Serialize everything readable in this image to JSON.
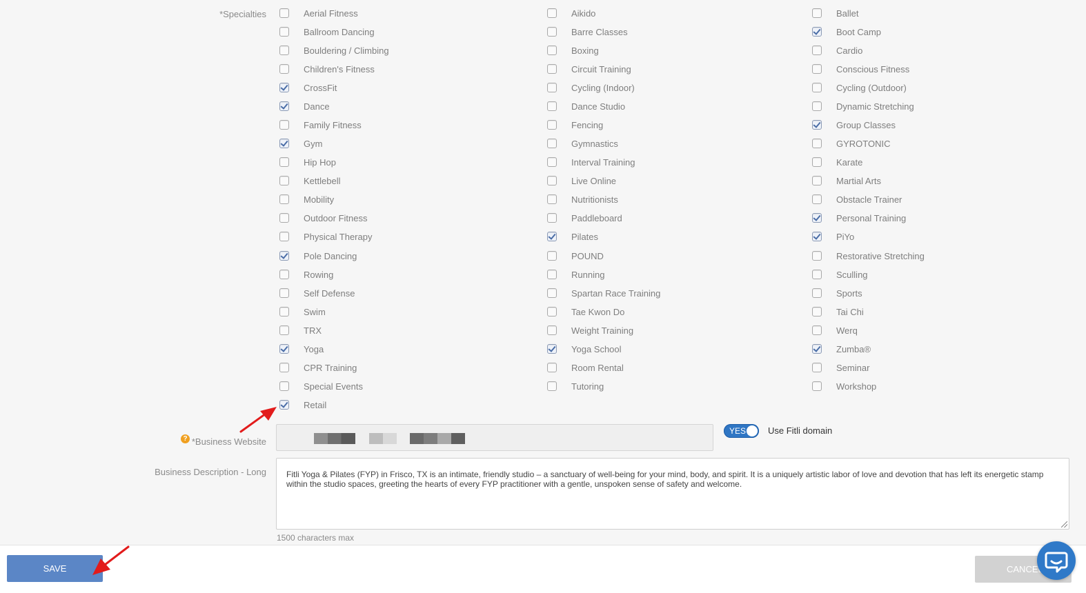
{
  "labels": {
    "specialties": "*Specialties",
    "business_website": "*Business Website",
    "business_description": "Business Description - Long",
    "char_limit": "1500 characters max",
    "use_domain": "Use Fitli domain",
    "toggle": "YES"
  },
  "business_description_value": "Fitli Yoga & Pilates (FYP) in Frisco, TX  is an intimate, friendly studio – a sanctuary of well-being for your mind, body, and spirit.  It is a uniquely artistic labor of love and devotion that has left its energetic stamp within the studio spaces, greeting the hearts of every FYP practitioner with a gentle, unspoken sense of safety and welcome.",
  "specialties": [
    {
      "label": "Aerial Fitness",
      "checked": false
    },
    {
      "label": "Aikido",
      "checked": false
    },
    {
      "label": "Ballet",
      "checked": false
    },
    {
      "label": "Ballroom Dancing",
      "checked": false
    },
    {
      "label": "Barre Classes",
      "checked": false
    },
    {
      "label": "Boot Camp",
      "checked": true
    },
    {
      "label": "Bouldering / Climbing",
      "checked": false
    },
    {
      "label": "Boxing",
      "checked": false
    },
    {
      "label": "Cardio",
      "checked": false
    },
    {
      "label": "Children's Fitness",
      "checked": false
    },
    {
      "label": "Circuit Training",
      "checked": false
    },
    {
      "label": "Conscious Fitness",
      "checked": false
    },
    {
      "label": "CrossFit",
      "checked": true
    },
    {
      "label": "Cycling (Indoor)",
      "checked": false
    },
    {
      "label": "Cycling (Outdoor)",
      "checked": false
    },
    {
      "label": "Dance",
      "checked": true
    },
    {
      "label": "Dance Studio",
      "checked": false
    },
    {
      "label": "Dynamic Stretching",
      "checked": false
    },
    {
      "label": "Family Fitness",
      "checked": false
    },
    {
      "label": "Fencing",
      "checked": false
    },
    {
      "label": "Group Classes",
      "checked": true
    },
    {
      "label": "Gym",
      "checked": true
    },
    {
      "label": "Gymnastics",
      "checked": false
    },
    {
      "label": "GYROTONIC",
      "checked": false
    },
    {
      "label": "Hip Hop",
      "checked": false
    },
    {
      "label": "Interval Training",
      "checked": false
    },
    {
      "label": "Karate",
      "checked": false
    },
    {
      "label": "Kettlebell",
      "checked": false
    },
    {
      "label": "Live Online",
      "checked": false
    },
    {
      "label": "Martial Arts",
      "checked": false
    },
    {
      "label": "Mobility",
      "checked": false
    },
    {
      "label": "Nutritionists",
      "checked": false
    },
    {
      "label": "Obstacle Trainer",
      "checked": false
    },
    {
      "label": "Outdoor Fitness",
      "checked": false
    },
    {
      "label": "Paddleboard",
      "checked": false
    },
    {
      "label": "Personal Training",
      "checked": true
    },
    {
      "label": "Physical Therapy",
      "checked": false
    },
    {
      "label": "Pilates",
      "checked": true
    },
    {
      "label": "PiYo",
      "checked": true
    },
    {
      "label": "Pole Dancing",
      "checked": true
    },
    {
      "label": "POUND",
      "checked": false
    },
    {
      "label": "Restorative Stretching",
      "checked": false
    },
    {
      "label": "Rowing",
      "checked": false
    },
    {
      "label": "Running",
      "checked": false
    },
    {
      "label": "Sculling",
      "checked": false
    },
    {
      "label": "Self Defense",
      "checked": false
    },
    {
      "label": "Spartan Race Training",
      "checked": false
    },
    {
      "label": "Sports",
      "checked": false
    },
    {
      "label": "Swim",
      "checked": false
    },
    {
      "label": "Tae Kwon Do",
      "checked": false
    },
    {
      "label": "Tai Chi",
      "checked": false
    },
    {
      "label": "TRX",
      "checked": false
    },
    {
      "label": "Weight Training",
      "checked": false
    },
    {
      "label": "Werq",
      "checked": false
    },
    {
      "label": "Yoga",
      "checked": true
    },
    {
      "label": "Yoga School",
      "checked": true
    },
    {
      "label": "Zumba®",
      "checked": true
    },
    {
      "label": "CPR Training",
      "checked": false
    },
    {
      "label": "Room Rental",
      "checked": false
    },
    {
      "label": "Seminar",
      "checked": false
    },
    {
      "label": "Special Events",
      "checked": false
    },
    {
      "label": "Tutoring",
      "checked": false
    },
    {
      "label": "Workshop",
      "checked": false
    },
    {
      "label": "Retail",
      "checked": true
    }
  ],
  "buttons": {
    "save": "SAVE",
    "cancel": "CANCEL"
  },
  "icons": {
    "help": "help-icon",
    "chat": "chat-icon",
    "annotation": "red-arrow"
  },
  "colors": {
    "accent": "#5b86c6",
    "toggle": "#2f76c4",
    "chat": "#2f79c8",
    "help": "#f0a020",
    "arrow": "#e21b1b"
  }
}
